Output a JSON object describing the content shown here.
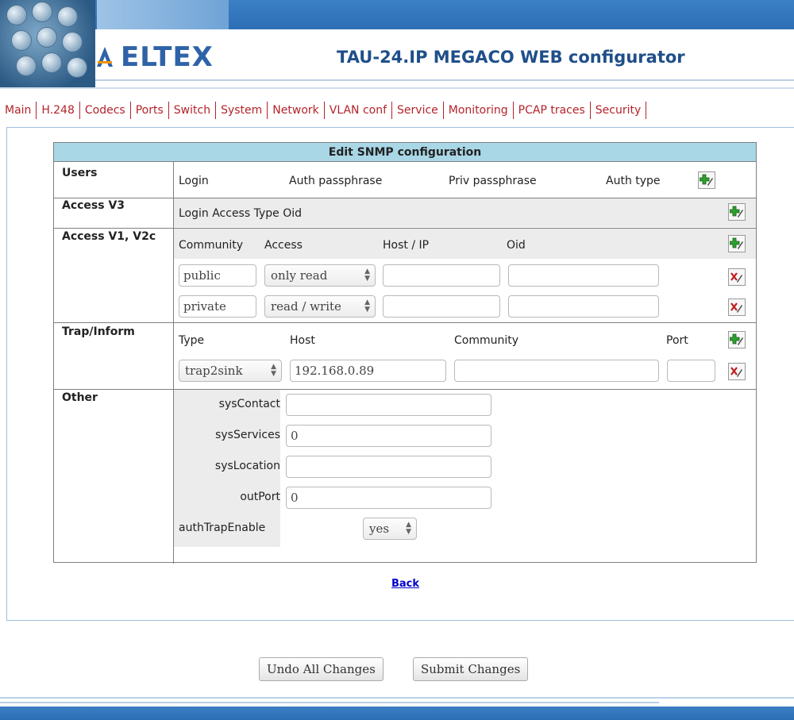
{
  "brand": {
    "logo": "ELTEX",
    "title": "TAU-24.IP MEGACO WEB configurator"
  },
  "nav": [
    "Main",
    "H.248",
    "Codecs",
    "Ports",
    "Switch",
    "System",
    "Network",
    "VLAN conf",
    "Service",
    "Monitoring",
    "PCAP traces",
    "Security"
  ],
  "snmp": {
    "title": "Edit SNMP configuration",
    "users": {
      "label": "Users",
      "columns": [
        "Login",
        "Auth passphrase",
        "Priv passphrase",
        "Auth type"
      ]
    },
    "access_v3": {
      "label": "Access V3",
      "columns": "Login Access Type Oid"
    },
    "access_v12": {
      "label": "Access V1, V2c",
      "columns": [
        "Community",
        "Access",
        "Host / IP",
        "Oid"
      ],
      "rows": [
        {
          "community": "public",
          "access": "only read",
          "host": "",
          "oid": ""
        },
        {
          "community": "private",
          "access": "read / write",
          "host": "",
          "oid": ""
        }
      ]
    },
    "trap": {
      "label": "Trap/Inform",
      "columns": [
        "Type",
        "Host",
        "Community",
        "Port"
      ],
      "rows": [
        {
          "type": "trap2sink",
          "host": "192.168.0.89",
          "community": "",
          "port": ""
        }
      ]
    },
    "other": {
      "label": "Other",
      "sysContact_label": "sysContact",
      "sysContact": "",
      "sysServices_label": "sysServices",
      "sysServices": "0",
      "sysLocation_label": "sysLocation",
      "sysLocation": "",
      "outPort_label": "outPort",
      "outPort": "0",
      "authTrapEnable_label": "authTrapEnable",
      "authTrapEnable": "yes"
    }
  },
  "back_link": "Back",
  "buttons": {
    "undo": "Undo All Changes",
    "submit": "Submit Changes"
  },
  "icons": {
    "add": "add-edit-icon",
    "delete": "delete-icon"
  }
}
